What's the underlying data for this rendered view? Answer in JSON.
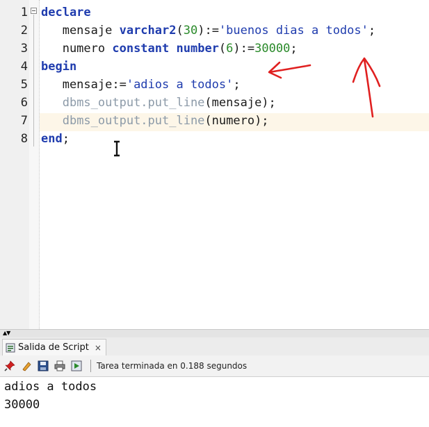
{
  "editor": {
    "line_numbers": [
      "1",
      "2",
      "3",
      "4",
      "5",
      "6",
      "7",
      "8"
    ],
    "lines": [
      {
        "tokens": [
          {
            "t": "declare",
            "c": "kw"
          }
        ]
      },
      {
        "tokens": [
          {
            "t": "   mensaje ",
            "c": ""
          },
          {
            "t": "varchar2",
            "c": "kw"
          },
          {
            "t": "(",
            "c": ""
          },
          {
            "t": "30",
            "c": "num"
          },
          {
            "t": "):=",
            "c": ""
          },
          {
            "t": "'buenos dias a todos'",
            "c": "str"
          },
          {
            "t": ";",
            "c": ""
          }
        ]
      },
      {
        "tokens": [
          {
            "t": "   numero ",
            "c": ""
          },
          {
            "t": "constant",
            "c": "kw"
          },
          {
            "t": " ",
            "c": ""
          },
          {
            "t": "number",
            "c": "kw"
          },
          {
            "t": "(",
            "c": ""
          },
          {
            "t": "6",
            "c": "num"
          },
          {
            "t": "):=",
            "c": ""
          },
          {
            "t": "30000",
            "c": "num"
          },
          {
            "t": ";",
            "c": ""
          }
        ]
      },
      {
        "tokens": [
          {
            "t": "begin",
            "c": "kw"
          }
        ]
      },
      {
        "tokens": [
          {
            "t": "   mensaje:=",
            "c": ""
          },
          {
            "t": "'adios a todos'",
            "c": "str"
          },
          {
            "t": ";",
            "c": ""
          }
        ]
      },
      {
        "tokens": [
          {
            "t": "   ",
            "c": ""
          },
          {
            "t": "dbms_output.put_line",
            "c": "call"
          },
          {
            "t": "(mensaje);",
            "c": ""
          }
        ]
      },
      {
        "tokens": [
          {
            "t": "   ",
            "c": ""
          },
          {
            "t": "dbms_output.put_line",
            "c": "call"
          },
          {
            "t": "(numero);",
            "c": ""
          }
        ]
      },
      {
        "tokens": [
          {
            "t": "end",
            "c": "kw"
          },
          {
            "t": ";",
            "c": ""
          }
        ]
      }
    ],
    "highlighted_line": "7",
    "annotation_color": "#e02020"
  },
  "output_panel": {
    "tab_label": "Salida de Script",
    "tab_close": "×",
    "status": "Tarea terminada en 0.188 segundos",
    "splitter_arrows": "▲▼",
    "output_lines": [
      "adios a todos",
      "30000"
    ]
  },
  "toolbar_icons": [
    "pin-icon",
    "eraser-icon",
    "save-icon",
    "print-icon",
    "run-script-icon"
  ]
}
